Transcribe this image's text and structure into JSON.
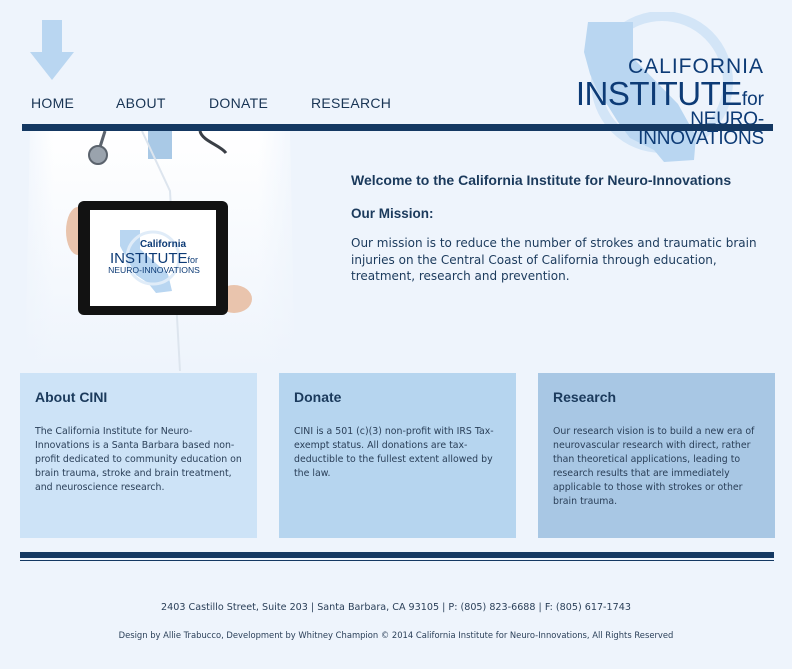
{
  "nav": {
    "items": [
      {
        "label": "HOME"
      },
      {
        "label": "ABOUT"
      },
      {
        "label": "DONATE"
      },
      {
        "label": "RESEARCH"
      }
    ]
  },
  "logo": {
    "line1": "CALIFORNIA",
    "line2": "INSTITUTE",
    "line2_suffix": "for",
    "line3": "NEURO-INNOVATIONS"
  },
  "tablet_logo": {
    "line1": "California",
    "line2": "INSTITUTE",
    "line2_suffix": "for",
    "line3": "NEURO-INNOVATIONS"
  },
  "main": {
    "welcome": "Welcome to the California Institute for Neuro-Innovations",
    "mission_title": "Our Mission:",
    "mission_text": "Our mission is to reduce the number of strokes and traumatic brain injuries on the Central Coast of California through education, treatment, research and prevention."
  },
  "cards": [
    {
      "title": "About CINI",
      "text": "The California Institute for Neuro-Innovations is a Santa Barbara based non-profit dedicated to community education on brain trauma, stroke and brain treatment, and neuroscience research."
    },
    {
      "title": "Donate",
      "text": "CINI is a 501 (c)(3) non-profit with IRS Tax-exempt status. All donations are tax-deductible to the fullest extent allowed by the law."
    },
    {
      "title": "Research",
      "text": "Our research vision is to build a new era of neurovascular research with direct, rather than theoretical applications, leading to research results that are immediately applicable to those with strokes or other brain trauma."
    }
  ],
  "footer": {
    "address": "2403 Castillo Street, Suite 203 | Santa Barbara, CA 93105 | P: (805) 823-6688 | F: (805) 617-1743",
    "credits": "Design by Allie Trabucco, Development by Whitney Champion © 2014 California Institute for Neuro-Innovations, All Rights Reserved"
  },
  "colors": {
    "background": "#eef4fc",
    "navy": "#143862",
    "logo_blue": "#0d3b76",
    "state_light_blue": "#b9d6f1",
    "card1": "#cde3f7",
    "card2": "#b6d5ef",
    "card3": "#a8c7e4"
  }
}
